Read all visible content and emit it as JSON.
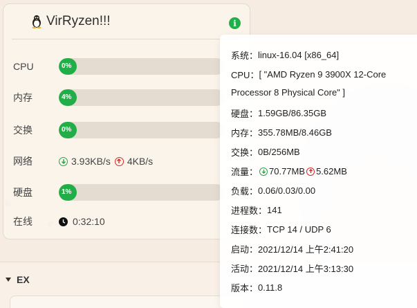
{
  "server": {
    "name": "VirRyzen!!!",
    "os_icon": "tux-icon",
    "info_icon": "info-icon"
  },
  "rows": {
    "cpu": {
      "label": "CPU",
      "value_text": "0%",
      "percent": 0
    },
    "memory": {
      "label": "内存",
      "value_text": "4%",
      "percent": 4
    },
    "swap": {
      "label": "交换",
      "value_text": "0%",
      "percent": 0
    },
    "network": {
      "label": "网络",
      "down": "3.93KB/s",
      "up": "4KB/s"
    },
    "disk": {
      "label": "硬盘",
      "value_text": "1%",
      "percent": 1
    },
    "uptime": {
      "label": "在线",
      "value": "0:32:10"
    }
  },
  "ex": {
    "label": "EX"
  },
  "popup": {
    "system": {
      "label": "系统：",
      "value": "linux-16.04 [x86_64]"
    },
    "cpu": {
      "label": "CPU：",
      "value_line1": "[ \"AMD Ryzen 9 3900X 12-Core",
      "value_line2": "Processor 8 Physical Core\" ]"
    },
    "disk": {
      "label": "硬盘：",
      "value": "1.59GB/86.35GB"
    },
    "memory": {
      "label": "内存：",
      "value": "355.78MB/8.46GB"
    },
    "swap": {
      "label": "交换：",
      "value": "0B/256MB"
    },
    "traffic": {
      "label": "流量：",
      "down": "70.77MB",
      "up": "5.62MB"
    },
    "load": {
      "label": "负载：",
      "value": "0.06/0.03/0.00"
    },
    "processes": {
      "label": "进程数：",
      "value": "141"
    },
    "connections": {
      "label": "连接数：",
      "value": "TCP 14 / UDP 6"
    },
    "boot": {
      "label": "启动：",
      "value": "2021/12/14 上午2:41:20"
    },
    "active": {
      "label": "活动：",
      "value": "2021/12/14 上午3:13:30"
    },
    "version": {
      "label": "版本：",
      "value": "0.11.8"
    }
  },
  "colors": {
    "accent_green": "#21ad47",
    "up_red": "#e02424",
    "bar_track": "#e5dcd1"
  }
}
